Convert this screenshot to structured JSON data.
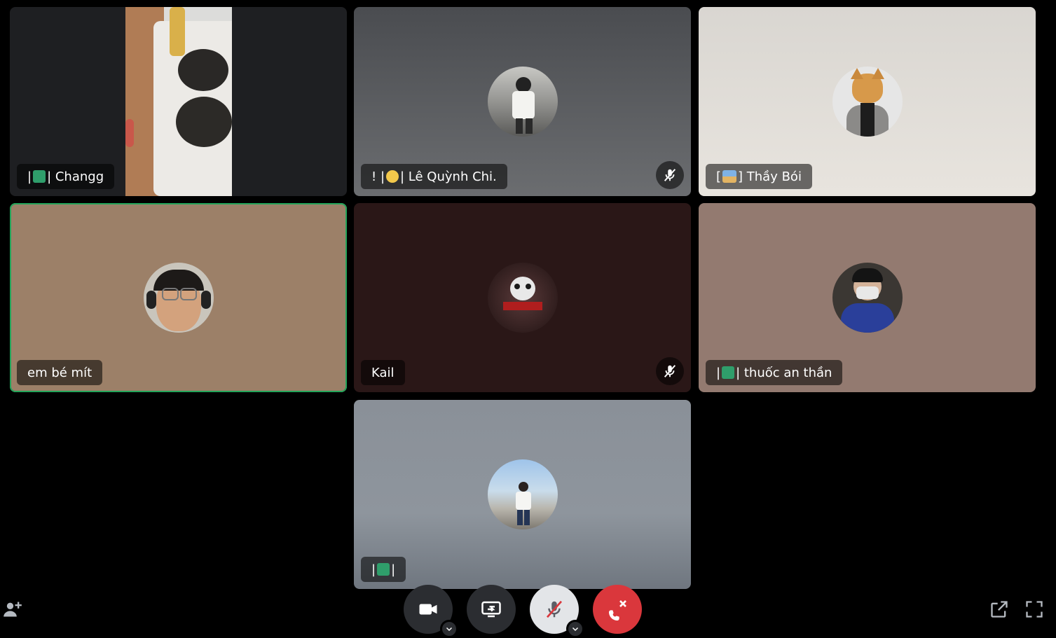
{
  "participants": [
    {
      "name": "| 🪂 | Changg",
      "pre": "|",
      "post": "| Changg",
      "emoji_color": "#2f9e6b",
      "muted": false,
      "bg": "#1e1f22"
    },
    {
      "name": "! | 🐣 | Lê Quỳnh Chi.",
      "pre": "! |",
      "post": "| Lê Quỳnh Chi.",
      "emoji_color": "#f2c84b",
      "muted": true,
      "bg": "#4a4c50"
    },
    {
      "name": "[ 🖼 ] Thầy Bói",
      "pre": "[",
      "post": "] Thầy Bói",
      "emoji_color": "#5b8fc7",
      "muted": false,
      "bg": "#e2ddd6"
    },
    {
      "name": "em bé mít",
      "pre": "",
      "post": "em bé mít",
      "emoji_color": "",
      "muted": false,
      "speaking": true,
      "bg": "#9c8068"
    },
    {
      "name": "Kail",
      "pre": "",
      "post": "Kail",
      "emoji_color": "",
      "muted": true,
      "bg": "#2a1717"
    },
    {
      "name": "| 🪂 | thuốc an thần",
      "pre": "|",
      "post": "| thuốc an thần",
      "emoji_color": "#2f9e6b",
      "muted": false,
      "bg": "#937a70"
    },
    {
      "name": "| 🪂 |",
      "pre": "|",
      "post": "|",
      "emoji_color": "#2f9e6b",
      "muted": false,
      "bg": "#8a929b"
    }
  ],
  "controls": {
    "camera": "camera-icon",
    "share": "screen-share-icon",
    "mic": "microphone-muted-icon",
    "leave": "leave-call-icon",
    "leave_color": "#da373c"
  },
  "utilities": {
    "add_friend": "add-user-icon",
    "popout": "popout-icon",
    "fullscreen": "fullscreen-icon"
  }
}
